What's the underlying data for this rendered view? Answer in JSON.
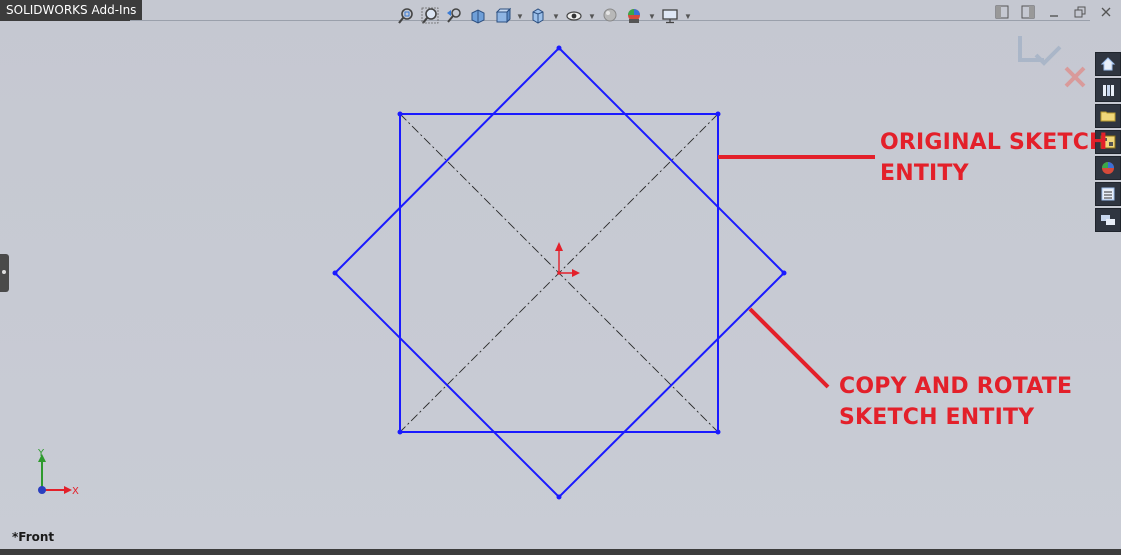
{
  "addins_tab": {
    "label": "SOLIDWORKS Add-Ins"
  },
  "view_label": "*Front",
  "annotations": {
    "original_line1": "ORIGINAL SKETCH",
    "original_line2": "ENTITY",
    "copy_line1": "COPY AND ROTATE",
    "copy_line2": "SKETCH ENTITY"
  },
  "triad": {
    "x_label": "X",
    "y_label": "Y"
  },
  "toolbar_icons": [
    "zoom-to-fit-icon",
    "zoom-to-area-icon",
    "previous-view-icon",
    "section-view-icon",
    "view-orientation-icon",
    "display-style-icon",
    "hide-show-items-icon",
    "edit-appearance-icon",
    "apply-scene-icon",
    "view-settings-icon"
  ],
  "task_pane_icons": [
    "home-icon",
    "design-library-icon",
    "file-explorer-icon",
    "view-palette-icon",
    "appearances-icon",
    "custom-properties-icon",
    "forum-icon"
  ],
  "colors": {
    "sketch": "#1a1aff",
    "annotation": "#e3202a",
    "centerline": "#2a2a2a",
    "origin": "#e3202a",
    "background": "#c7cad3"
  }
}
